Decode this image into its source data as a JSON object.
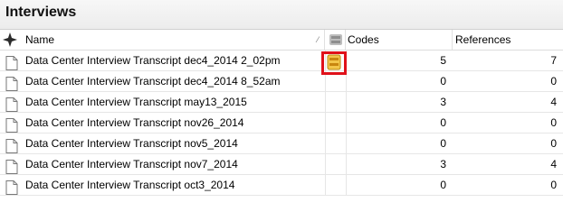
{
  "panel": {
    "title": "Interviews"
  },
  "columns": {
    "name": "Name",
    "codes": "Codes",
    "references": "References"
  },
  "rows": [
    {
      "name": "Data Center Interview Transcript dec4_2014 2_02pm",
      "codes": "5",
      "references": "7"
    },
    {
      "name": "Data Center Interview Transcript dec4_2014 8_52am",
      "codes": "0",
      "references": "0"
    },
    {
      "name": "Data Center Interview Transcript may13_2015",
      "codes": "3",
      "references": "4"
    },
    {
      "name": "Data Center Interview Transcript nov26_2014",
      "codes": "0",
      "references": "0"
    },
    {
      "name": "Data Center Interview Transcript nov5_2014",
      "codes": "0",
      "references": "0"
    },
    {
      "name": "Data Center Interview Transcript nov7_2014",
      "codes": "3",
      "references": "4"
    },
    {
      "name": "Data Center Interview Transcript oct3_2014",
      "codes": "0",
      "references": "0"
    }
  ],
  "icons": {
    "select_all": "pin-icon",
    "sort": "sort-arrow-icon",
    "coded_by": "coded-by-icon",
    "row_type": "document-icon"
  },
  "colors": {
    "highlight": "#e0111a",
    "coded_icon": "#f3c64a"
  }
}
